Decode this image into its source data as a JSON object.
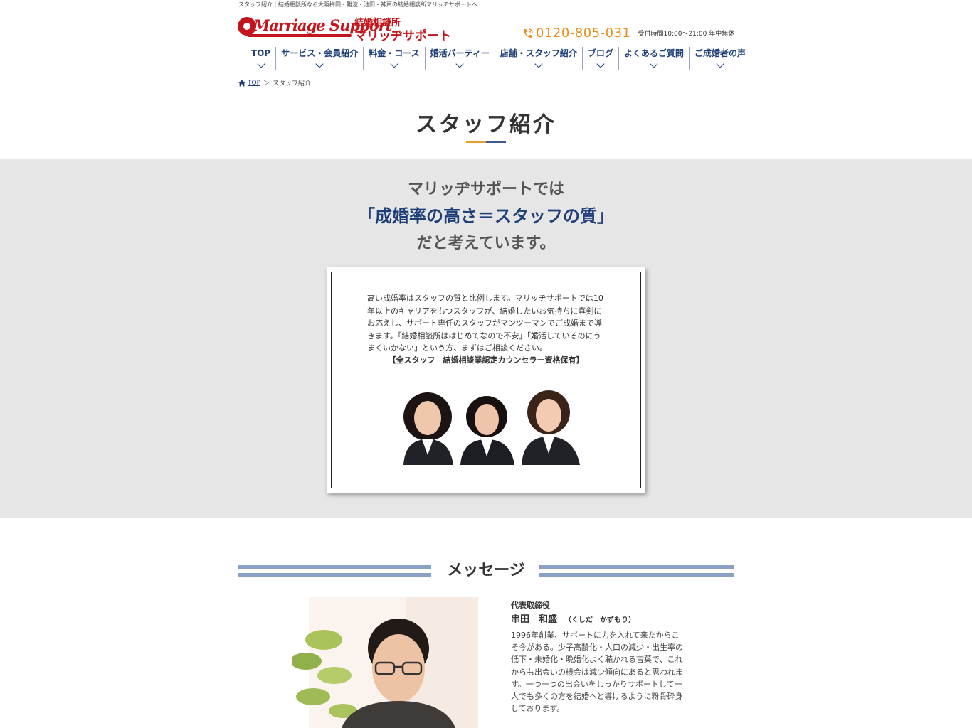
{
  "header": {
    "tagline": "スタッフ紹介｜結婚相談所なら大阪梅田・難波・池田・神戸の結婚相談所マリッヂサポートへ",
    "logo": {
      "script_text": "Marriage Support",
      "jp_line1": "結婚相談所",
      "jp_line2": "マリッヂサポート"
    },
    "phone": {
      "number": "0120-805-031",
      "hours": "受付時間10:00〜21:00 年中無休"
    }
  },
  "nav": {
    "items": [
      {
        "label": "TOP"
      },
      {
        "label": "サービス・会員紹介"
      },
      {
        "label": "料金・コース"
      },
      {
        "label": "婚活パーティー"
      },
      {
        "label": "店舗・スタッフ紹介"
      },
      {
        "label": "ブログ"
      },
      {
        "label": "よくあるご質問"
      },
      {
        "label": "ご成婚者の声"
      }
    ]
  },
  "breadcrumb": {
    "top": "TOP",
    "separator": "＞",
    "current": "スタッフ紹介"
  },
  "page": {
    "title": "スタッフ紹介"
  },
  "intro": {
    "line1": "マリッヂサポートでは",
    "line2": "「成婚率の高さ＝スタッフの質」",
    "line3": "だと考えています。"
  },
  "card": {
    "body": "高い成婚率はスタッフの質と比例します。マリッヂサポートでは10年以上のキャリアをもつスタッフが、結婚したいお気持ちに真剣にお応えし、サポート専任のスタッフがマンツーマンでご成婚まで導きます。「結婚相談所ははじめてなので不安」「婚活しているのにうまくいかない」という方、まずはご相談ください。",
    "cert": "【全スタッフ　結婚相談業認定カウンセラー資格保有】"
  },
  "message": {
    "heading": "メッセージ",
    "role": "代表取締役",
    "name": "串田　和盛",
    "reading": "（くしだ　かずもり）",
    "bio": "1996年創業、サポートに力を入れて来たからこそ今がある。少子高齢化・人口の減少・出生率の低下・未婚化・晩婚化よく聴かれる言葉で、これからも出会いの機会は減少傾向にあると思われます。一つ一つの出会いをしっかりサポートして一人でも多くの方を結婚へと導けるように粉骨砕身しております。"
  },
  "colors": {
    "brand_red": "#c4151c",
    "nav_blue": "#1f3f79",
    "phone_orange": "#ec8d1a",
    "band_gray": "#e6e6e6",
    "stripe_blue": "#8aa0c4"
  }
}
